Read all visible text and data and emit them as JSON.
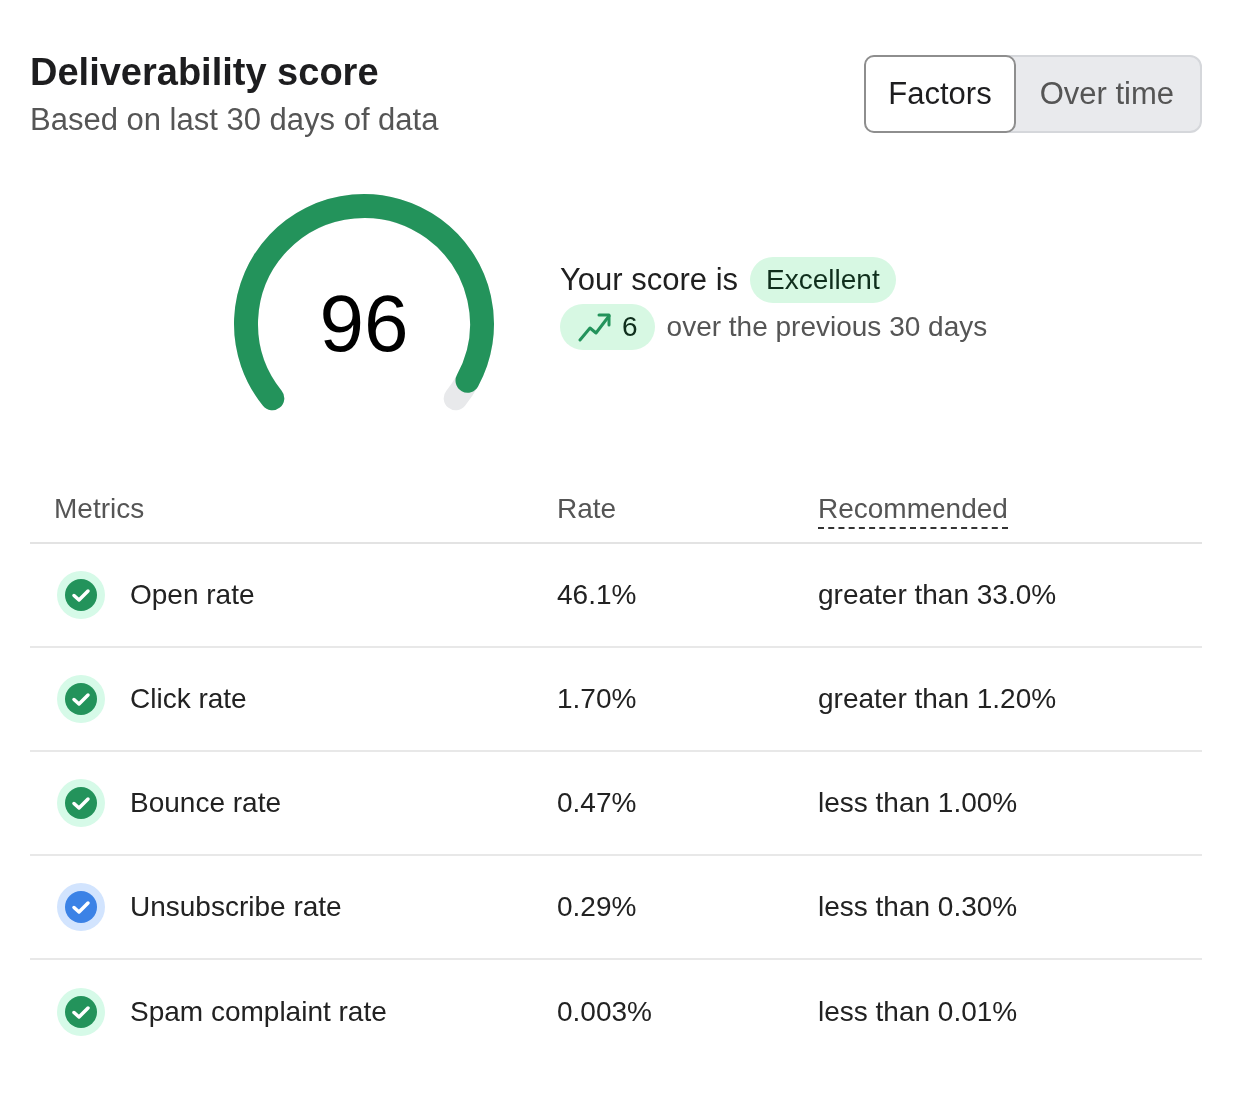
{
  "header": {
    "title": "Deliverability score",
    "subtitle": "Based on last 30 days of data"
  },
  "view_toggle": [
    {
      "label": "Factors",
      "selected": true
    },
    {
      "label": "Over time",
      "selected": false
    }
  ],
  "score": {
    "value": "96",
    "level": 0.96,
    "label": "Your score is",
    "rating": "Excellent",
    "change": "6",
    "change_note": "over the previous 30 days"
  },
  "table": {
    "columns": [
      {
        "label": "Metrics",
        "underlined": false
      },
      {
        "label": "Rate",
        "underlined": false
      },
      {
        "label": "Recommended",
        "underlined": true
      }
    ],
    "rows": [
      {
        "metric": "Open rate",
        "rate": "46.1%",
        "recommended": "greater than 33.0%",
        "color": "#23935b"
      },
      {
        "metric": "Click rate",
        "rate": "1.70%",
        "recommended": "greater than 1.20%",
        "color": "#23935b"
      },
      {
        "metric": "Bounce rate",
        "rate": "0.47%",
        "recommended": "less than 1.00%",
        "color": "#23935b"
      },
      {
        "metric": "Unsubscribe rate",
        "rate": "0.29%",
        "recommended": "less than 0.30%",
        "color": "#3b82e6"
      },
      {
        "metric": "Spam complaint rate",
        "rate": "0.003%",
        "recommended": "less than 0.01%",
        "color": "#23935b"
      }
    ]
  }
}
